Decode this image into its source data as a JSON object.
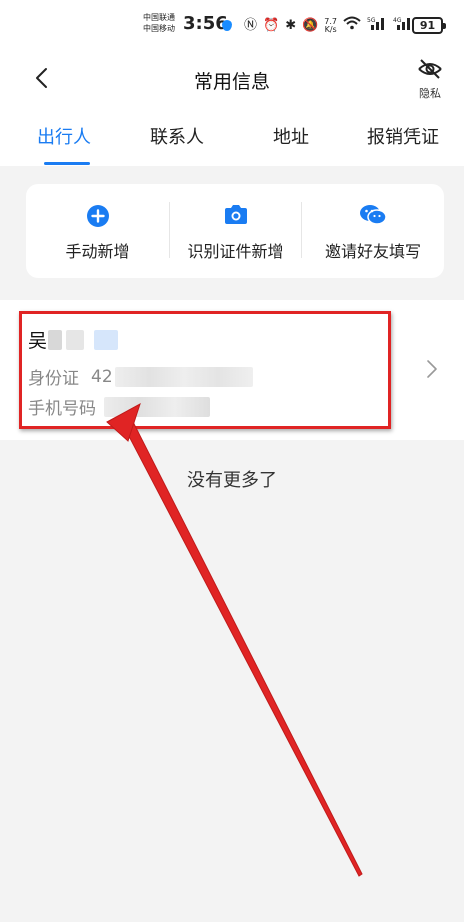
{
  "status_bar": {
    "carrier_1": "中国联通",
    "carrier_2": "中国移动",
    "time": "3:56",
    "speed_value": "7.7",
    "speed_unit": "K/s",
    "battery": "91"
  },
  "nav": {
    "title": "常用信息",
    "privacy_label": "隐私"
  },
  "tabs": [
    {
      "label": "出行人",
      "active": true
    },
    {
      "label": "联系人",
      "active": false
    },
    {
      "label": "地址",
      "active": false
    },
    {
      "label": "报销凭证",
      "active": false
    }
  ],
  "actions": [
    {
      "label": "手动新增",
      "icon": "plus-circle-icon"
    },
    {
      "label": "识别证件新增",
      "icon": "camera-icon"
    },
    {
      "label": "邀请好友填写",
      "icon": "wechat-icon"
    }
  ],
  "passenger": {
    "name_visible": "吴",
    "id_label": "身份证",
    "id_visible": "42",
    "phone_label": "手机号码"
  },
  "empty_text": "没有更多了",
  "colors": {
    "accent": "#1a7cf2",
    "highlight": "#e02424"
  }
}
